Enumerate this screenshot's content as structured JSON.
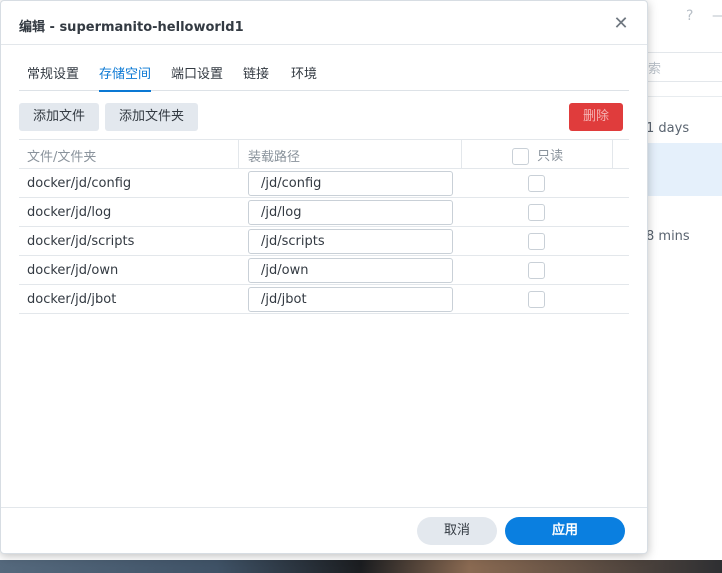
{
  "background": {
    "help_icon": "?",
    "search_placeholder": "索",
    "rows": [
      {
        "text": "1 days"
      },
      {
        "text": "8 mins"
      }
    ]
  },
  "dialog": {
    "title": "编辑 - supermanito-helloworld1",
    "close_icon": "✕",
    "tabs": [
      {
        "label": "常规设置",
        "active": false
      },
      {
        "label": "存储空间",
        "active": true
      },
      {
        "label": "端口设置",
        "active": false
      },
      {
        "label": "链接",
        "active": false
      },
      {
        "label": "环境",
        "active": false
      }
    ],
    "toolbar": {
      "add_file": "添加文件",
      "add_folder": "添加文件夹",
      "delete": "删除"
    },
    "table": {
      "headers": {
        "folder": "文件/文件夹",
        "mount_path": "装载路径",
        "readonly": "只读"
      },
      "rows": [
        {
          "folder": "docker/jd/config",
          "mount": "/jd/config",
          "readonly": false
        },
        {
          "folder": "docker/jd/log",
          "mount": "/jd/log",
          "readonly": false
        },
        {
          "folder": "docker/jd/scripts",
          "mount": "/jd/scripts",
          "readonly": false
        },
        {
          "folder": "docker/jd/own",
          "mount": "/jd/own",
          "readonly": false
        },
        {
          "folder": "docker/jd/jbot",
          "mount": "/jd/jbot",
          "readonly": false
        }
      ]
    },
    "footer": {
      "cancel": "取消",
      "apply": "应用"
    },
    "colors": {
      "accent": "#0a78d4",
      "danger": "#e03c3c",
      "apply": "#0a7fe0"
    }
  }
}
